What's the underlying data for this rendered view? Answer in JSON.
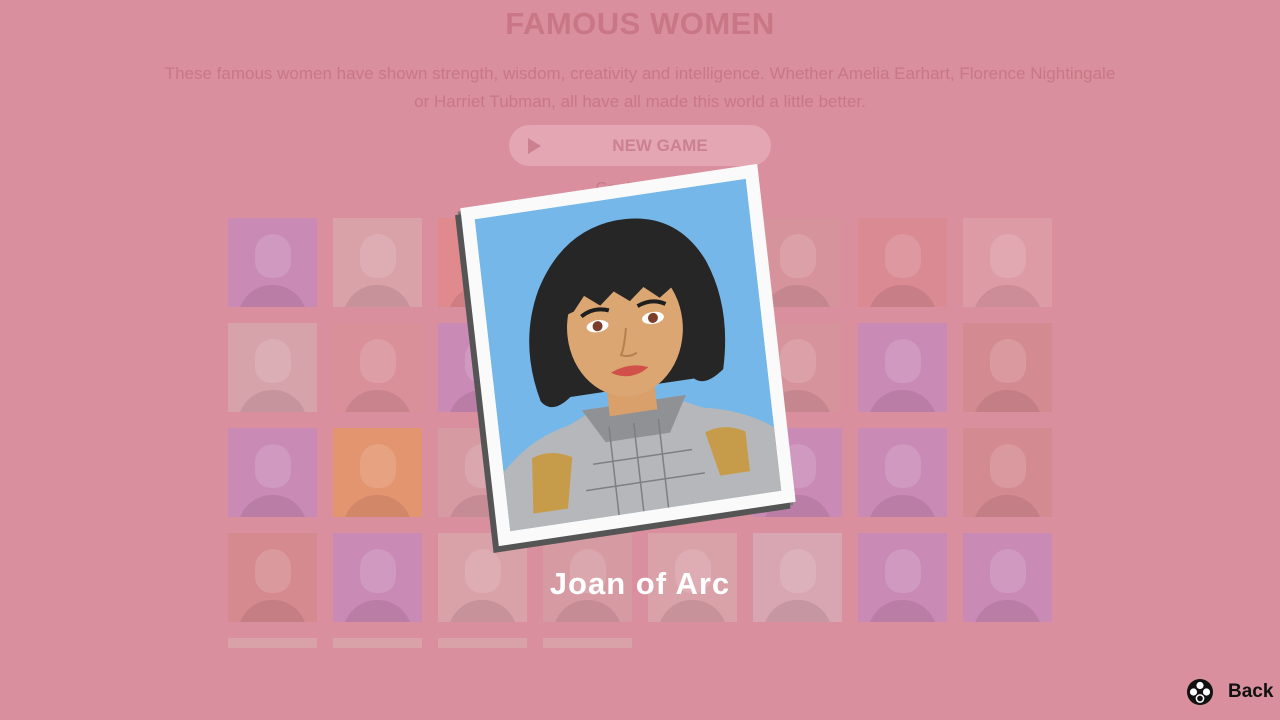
{
  "page": {
    "title": "FAMOUS WOMEN",
    "description": "These famous women have shown strength, wisdom, creativity and intelligence. Whether Amelia Earhart, Florence Nightingale or Harriet Tubman, all have all made this world a little better.",
    "new_game_label": "NEW GAME",
    "cards_info": "Cards in this"
  },
  "tiles": {
    "colors": [
      "#c98ab6",
      "#d9a1a8",
      "#e08a8d",
      "#d69aa3",
      "#d69aa3",
      "#d7939c",
      "#d98a92",
      "#dd9ba6",
      "#d6a3aa",
      "#d99098",
      "#c98ab6",
      "#d69aa3",
      "#d69aa3",
      "#d7939c",
      "#c98ab6",
      "#d48a91",
      "#c98ab6",
      "#e3956f",
      "#d69aa3",
      "#d69aa3",
      "#d69aa3",
      "#c98ab6",
      "#c98ab6",
      "#d48a91",
      "#d48a8f",
      "#c98ab6",
      "#d9a1a8",
      "#d69aa3",
      "#d9a1a8",
      "#d8a6b2",
      "#c98ab6",
      "#c98ab6",
      "#d9a1a8",
      "#d9a1a8",
      "#d9a1a8",
      "#d9a1a8"
    ]
  },
  "overlay": {
    "card_name": "Joan of Arc",
    "background_color": "#74b7e8"
  },
  "controls": {
    "back_label": "Back",
    "back_icon": "controller-buttons-icon"
  }
}
